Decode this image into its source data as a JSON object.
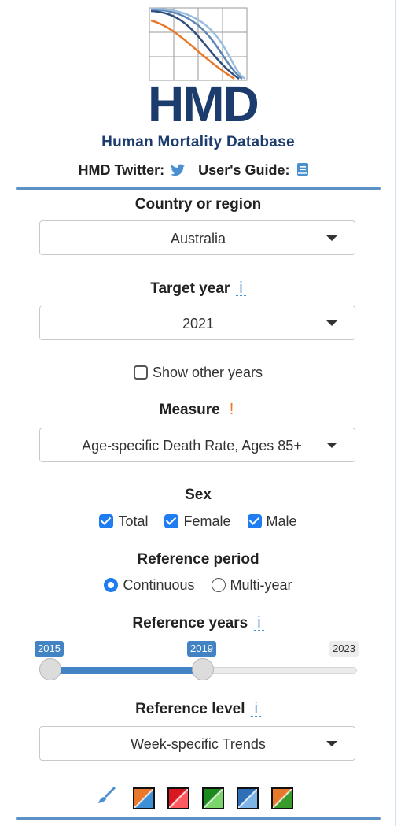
{
  "header": {
    "logo_text": "HMD",
    "title": "Human Mortality Database",
    "twitter_label": "HMD Twitter:",
    "guide_label": "User's Guide:",
    "icons": [
      "twitter-icon",
      "book-icon"
    ]
  },
  "country": {
    "label": "Country or region",
    "value": "Australia"
  },
  "target_year": {
    "label": "Target year",
    "info": "i",
    "value": "2021"
  },
  "show_other_years": {
    "label": "Show other years",
    "checked": false
  },
  "measure": {
    "label": "Measure",
    "warn": "!",
    "value": "Age-specific Death Rate, Ages 85+"
  },
  "sex": {
    "label": "Sex",
    "options": [
      {
        "label": "Total",
        "checked": true
      },
      {
        "label": "Female",
        "checked": true
      },
      {
        "label": "Male",
        "checked": true
      }
    ]
  },
  "reference_period": {
    "label": "Reference period",
    "options": [
      {
        "label": "Continuous",
        "selected": true
      },
      {
        "label": "Multi-year",
        "selected": false
      }
    ]
  },
  "reference_years": {
    "label": "Reference years",
    "info": "i",
    "min": 2015,
    "max": 2023,
    "from": "2015",
    "to": "2019",
    "max_label": "2023"
  },
  "reference_level": {
    "label": "Reference level",
    "info": "i",
    "value": "Week-specific Trends"
  },
  "palette": {
    "icon": "paintbrush-icon",
    "swatches": [
      {
        "name": "orange-blue",
        "colors": [
          "#e8782a",
          "#3e8fd6"
        ]
      },
      {
        "name": "red",
        "colors": [
          "#d8191f",
          "#ff5a60"
        ]
      },
      {
        "name": "green",
        "colors": [
          "#1c8a1c",
          "#7ad66b"
        ]
      },
      {
        "name": "blue",
        "colors": [
          "#2f6fb8",
          "#7fb4e6"
        ]
      },
      {
        "name": "orange-green",
        "colors": [
          "#e8782a",
          "#3a9b2d"
        ]
      }
    ]
  },
  "colors": {
    "accent": "#4283c4",
    "brand": "#1d3c6e",
    "checkbox": "#1f7cf1"
  }
}
